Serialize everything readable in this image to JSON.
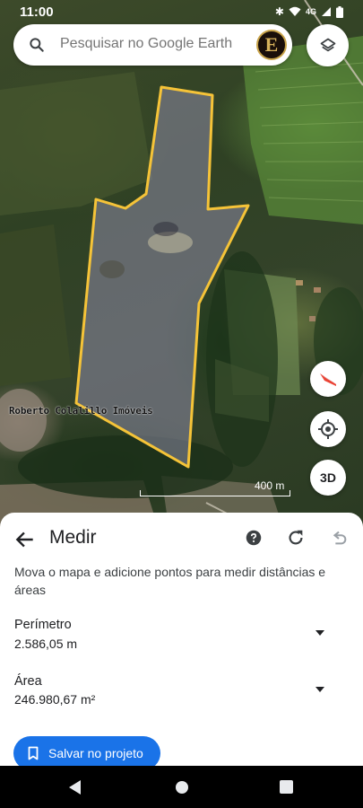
{
  "status_bar": {
    "time": "11:00",
    "network": "4G"
  },
  "search": {
    "placeholder": "Pesquisar no Google Earth",
    "avatar_letter": "E"
  },
  "map": {
    "watermark": "Roberto Colalillo Imóveis",
    "scale_label": "400 m",
    "threed_label": "3D"
  },
  "sheet": {
    "title": "Medir",
    "instructions": "Mova o mapa e adicione pontos para medir distâncias e áreas",
    "perimeter_label": "Perímetro",
    "perimeter_value": "2.586,05 m",
    "area_label": "Área",
    "area_value": "246.980,67 m²",
    "save_label": "Salvar no projeto"
  },
  "colors": {
    "polygon": "#f5c338",
    "accent": "#1a73e8"
  }
}
